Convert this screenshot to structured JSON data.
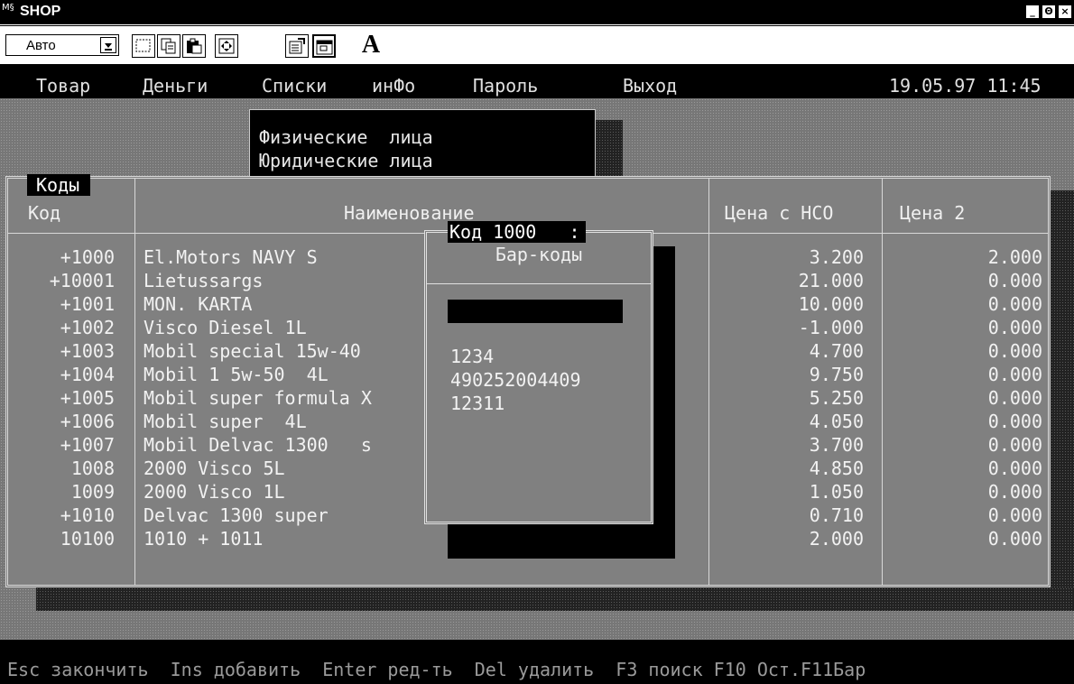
{
  "window": {
    "icon_text": "M§",
    "title": "SHOP",
    "controls": [
      "_",
      "Θ",
      "×"
    ]
  },
  "toolbar": {
    "font_select_value": "Авто",
    "text_button": "A"
  },
  "menu": {
    "items": [
      "Товар",
      "Деньги",
      "Списки",
      "инФо",
      "Пароль",
      "Выход"
    ],
    "datetime": "19.05.97 11:45"
  },
  "dropdown": {
    "items": [
      "Физические  лица",
      "Юридические лица"
    ]
  },
  "codes": {
    "title": "Коды",
    "columns": [
      "Код",
      "Наименование",
      "Цена с НСО",
      "Цена 2"
    ],
    "rows": [
      {
        "code": "+1000",
        "name": "El.Motors NAVY S",
        "price": "3.200",
        "price2": "2.000"
      },
      {
        "code": "+10001",
        "name": "Lietussargs",
        "price": "21.000",
        "price2": "0.000"
      },
      {
        "code": "+1001",
        "name": "MON. KARTA",
        "price": "10.000",
        "price2": "0.000"
      },
      {
        "code": "+1002",
        "name": "Visco Diesel 1L",
        "price": "-1.000",
        "price2": "0.000"
      },
      {
        "code": "+1003",
        "name": "Mobil special 15w-40",
        "price": "4.700",
        "price2": "0.000"
      },
      {
        "code": "+1004",
        "name": "Mobil 1 5w-50  4L",
        "price": "9.750",
        "price2": "0.000"
      },
      {
        "code": "+1005",
        "name": "Mobil super formula X",
        "price": "5.250",
        "price2": "0.000"
      },
      {
        "code": "+1006",
        "name": "Mobil super  4L",
        "price": "4.050",
        "price2": "0.000"
      },
      {
        "code": "+1007",
        "name": "Mobil Delvac 1300   s",
        "price": "3.700",
        "price2": "0.000"
      },
      {
        "code": "1008",
        "name": "2000 Visco 5L",
        "price": "4.850",
        "price2": "0.000"
      },
      {
        "code": "1009",
        "name": "2000 Visco 1L",
        "price": "1.050",
        "price2": "0.000"
      },
      {
        "code": "+1010",
        "name": "Delvac 1300 super",
        "price": "0.710",
        "price2": "0.000"
      },
      {
        "code": "10100",
        "name": "1010 + 1011",
        "price": "2.000",
        "price2": "0.000"
      }
    ]
  },
  "barcodes": {
    "title": "Код 1000   :",
    "header": "Бар-коды",
    "input_value": "",
    "items": [
      "1234",
      "490252004409",
      "12311"
    ]
  },
  "status_bar": "Esc закончить  Ins добавить  Enter ред-ть  Del удалить  F3 поиск F10 Ост.F11Бар"
}
